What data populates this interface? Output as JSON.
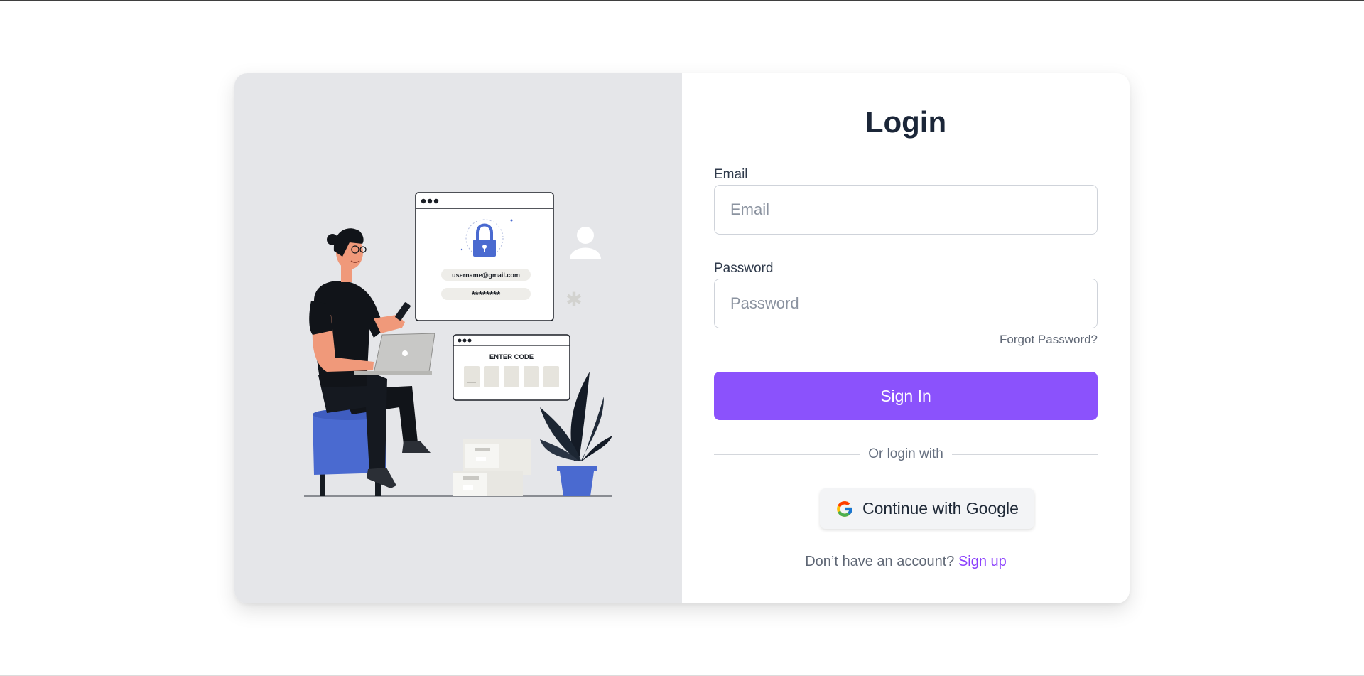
{
  "illustration": {
    "email_text": "username@gmail.com",
    "password_mask": "********",
    "code_title": "ENTER CODE"
  },
  "form": {
    "title": "Login",
    "email_label": "Email",
    "email_placeholder": "Email",
    "email_value": "",
    "password_label": "Password",
    "password_placeholder": "Password",
    "password_value": "",
    "forgot_label": "Forgot Password?",
    "signin_label": "Sign In",
    "divider_label": "Or login with",
    "google_label": "Continue with Google",
    "signup_prompt": "Don’t have an account?",
    "signup_link": "Sign up"
  },
  "colors": {
    "accent": "#8b52fc",
    "link": "#8a3ffc",
    "illustration_panel": "#e5e6e9",
    "illustration_blue": "#4a6ad0"
  },
  "icons": [
    "google-icon",
    "lock-icon",
    "user-icon"
  ]
}
